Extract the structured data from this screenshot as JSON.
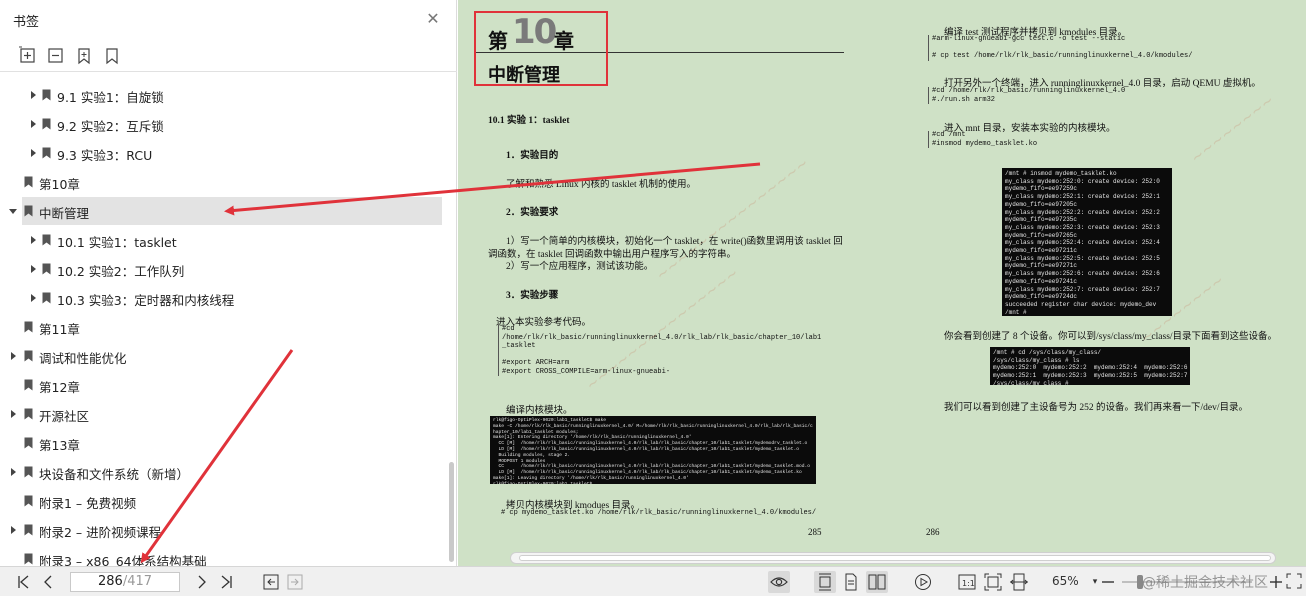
{
  "sidebar": {
    "title": "书签",
    "items": [
      {
        "label": "9.1 实验1：自旋锁",
        "level": 1,
        "arrow": "right",
        "selected": false
      },
      {
        "label": "9.2 实验2：互斥锁",
        "level": 1,
        "arrow": "right",
        "selected": false
      },
      {
        "label": "9.3 实验3：RCU",
        "level": 1,
        "arrow": "right",
        "selected": false
      },
      {
        "label": "第10章",
        "level": 0,
        "arrow": "none",
        "selected": false
      },
      {
        "label": "中断管理",
        "level": 0,
        "arrow": "down",
        "selected": true
      },
      {
        "label": "10.1 实验1：tasklet",
        "level": 1,
        "arrow": "right",
        "selected": false
      },
      {
        "label": "10.2 实验2：工作队列",
        "level": 1,
        "arrow": "right",
        "selected": false
      },
      {
        "label": "10.3 实验3：定时器和内核线程",
        "level": 1,
        "arrow": "right",
        "selected": false
      },
      {
        "label": "第11章",
        "level": 0,
        "arrow": "none",
        "selected": false
      },
      {
        "label": "调试和性能优化",
        "level": 0,
        "arrow": "right",
        "selected": false
      },
      {
        "label": "第12章",
        "level": 0,
        "arrow": "none",
        "selected": false
      },
      {
        "label": "开源社区",
        "level": 0,
        "arrow": "right",
        "selected": false
      },
      {
        "label": "第13章",
        "level": 0,
        "arrow": "none",
        "selected": false
      },
      {
        "label": "块设备和文件系统（新增）",
        "level": 0,
        "arrow": "right",
        "selected": false
      },
      {
        "label": "附录1 – 免费视频",
        "level": 0,
        "arrow": "none",
        "selected": false
      },
      {
        "label": "附录2 – 进阶视频课程",
        "level": 0,
        "arrow": "right",
        "selected": false
      },
      {
        "label": "附录3 – x86_64体系结构基础",
        "level": 0,
        "arrow": "none",
        "selected": false
      }
    ]
  },
  "doc": {
    "left": {
      "chapter_prefix": "第",
      "chapter_number": "10",
      "chapter_suffix": "章",
      "chapter_title": "中断管理",
      "section": "10.1 实验 1：tasklet",
      "h_purpose": "1．实验目的",
      "p_purpose": "了解和熟悉 Linux 内核的 tasklet 机制的使用。",
      "h_req": "2．实验要求",
      "p_req1": "1）写一个简单的内核模块，初始化一个 tasklet，在 write()函数里调用该 tasklet 回",
      "p_req2": "调函数，在 tasklet 回调函数中输出用户程序写入的字符串。",
      "p_req3": "2）写一个应用程序，测试该功能。",
      "h_steps": "3．实验步骤",
      "p_ref": "进入本实验参考代码。",
      "code1": "#cd\n/home/rlk/rlk_basic/runninglinuxkernel_4.0/rlk_lab/rlk_basic/chapter_10/lab1\n_tasklet\n\n#export ARCH=arm\n#export CROSS_COMPILE=arm-linux-gnueabi-",
      "p_compile": "编译内核模块。",
      "term1": "rlk@figo-OptiPlex-9020:lab1_tasklet$ make\nmake -C /home/rlk/rlk_basic/runninglinuxkernel_4.0/ M=/home/rlk/rlk_basic/runninglinuxkernel_4.0/rlk_lab/rlk_basic/c\nhapter_10/lab1_tasklet modules;\nmake[1]: Entering directory '/home/rlk/rlk_basic/runninglinuxkernel_4.0'\n  CC [M]  /home/rlk/rlk_basic/runninglinuxkernel_4.0/rlk_lab/rlk_basic/chapter_10/lab1_tasklet/mydemodrv_tasklet.o\n  LD [M]  /home/rlk/rlk_basic/runninglinuxkernel_4.0/rlk_lab/rlk_basic/chapter_10/lab1_tasklet/mydemo_tasklet.o\n  Building modules, stage 2.\n  MODPOST 1 modules\n  CC      /home/rlk/rlk_basic/runninglinuxkernel_4.0/rlk_lab/rlk_basic/chapter_10/lab1_tasklet/mydemo_tasklet.mod.o\n  LD [M]  /home/rlk/rlk_basic/runninglinuxkernel_4.0/rlk_lab/rlk_basic/chapter_10/lab1_tasklet/mydemo_tasklet.ko\nmake[1]: Leaving directory '/home/rlk/rlk_basic/runninglinuxkernel_4.0'\nrlk@figo-OptiPlex-9020:lab1_tasklet$",
      "p_copy": "拷贝内核模块到 kmodues 目录。",
      "code_copy": "# cp mydemo_tasklet.ko /home/rlk/rlk_basic/runninglinuxkernel_4.0/kmodules/",
      "page_number": "285"
    },
    "right": {
      "p1": "编译 test 测试程序并拷贝到 kmodules 目录。",
      "code1": "#arm-linux-gnueabi-gcc test.c -o test --static\n\n# cp test /home/rlk/rlk_basic/runninglinuxkernel_4.0/kmodules/",
      "p2": "打开另外一个终端，进入 runninglinuxkernel_4.0 目录，启动 QEMU 虚拟机。",
      "code2": "#cd /home/rlk/rlk_basic/runninglinuxkernel_4.0\n#./run.sh arm32",
      "p3": "进入 mnt 目录，安装本实验的内核模块。",
      "code3": "#cd /mnt\n#insmod mydemo_tasklet.ko",
      "term1": "/mnt # insmod mydemo_tasklet.ko\nmy_class mydemo:252:0: create device: 252:0\nmydemo_fifo=ee97259c\nmy_class mydemo:252:1: create device: 252:1\nmydemo_fifo=ee97205c\nmy_class mydemo:252:2: create device: 252:2\nmydemo_fifo=ee97235c\nmy_class mydemo:252:3: create device: 252:3\nmydemo_fifo=ee97265c\nmy_class mydemo:252:4: create device: 252:4\nmydemo_fifo=ee97211c\nmy_class mydemo:252:5: create device: 252:5\nmydemo_fifo=ee97271c\nmy_class mydemo:252:6: create device: 252:6\nmydemo_fifo=ee97241c\nmy_class mydemo:252:7: create device: 252:7\nmydemo_fifo=ee9724dc\nsucceeded register char device: mydemo_dev\n/mnt #",
      "p4": "你会看到创建了 8 个设备。你可以到/sys/class/my_class/目录下面看到这些设备。",
      "term2": "/mnt # cd /sys/class/my_class/\n/sys/class/my_class # ls\nmydemo:252:0  mydemo:252:2  mydemo:252:4  mydemo:252:6\nmydemo:252:1  mydemo:252:3  mydemo:252:5  mydemo:252:7\n/sys/class/my_class #",
      "p5": "我们可以看到创建了主设备号为 252 的设备。我们再来看一下/dev/目录。",
      "page_number": "286"
    }
  },
  "bottombar": {
    "current_page": "286",
    "total_pages": "/417",
    "zoom": "65%",
    "zoom_fraction": 0.14,
    "watermark": "@稀土掘金技术社区"
  },
  "icons": {
    "close": "close-icon",
    "first": "first-page-icon",
    "prev": "prev-page-icon",
    "next": "next-page-icon",
    "last": "last-page-icon"
  },
  "colors": {
    "annotation_red": "#e0323a",
    "doc_bg": "#cfe1c6",
    "selected_row": "#e3e3e3"
  }
}
